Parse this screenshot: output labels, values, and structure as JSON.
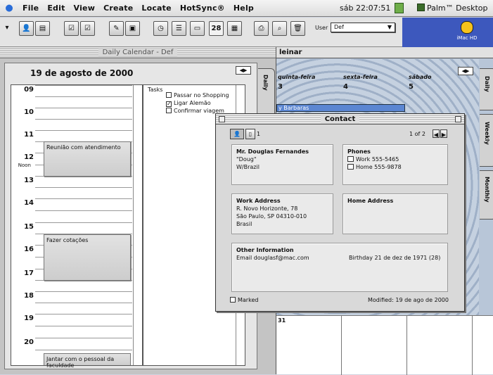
{
  "menubar": {
    "items": [
      "File",
      "Edit",
      "View",
      "Create",
      "Locate",
      "HotSync®",
      "Help"
    ],
    "clock": "sáb 22:07:51",
    "app_name": "Palm™ Desktop"
  },
  "toolbar": {
    "user_label": "User",
    "user_value": "Def",
    "date_button": "28"
  },
  "desktop": {
    "hd_label": "iMac HD"
  },
  "calendar": {
    "window_title": "Daily Calendar - Def",
    "date": "19 de agosto de 2000",
    "hours": [
      "09",
      "10",
      "11",
      "12",
      "13",
      "14",
      "15",
      "16",
      "17",
      "18",
      "19",
      "20"
    ],
    "noon_label": "Noon",
    "appointments": [
      "Reunião com atendimento",
      "Fazer cotações",
      "Jantar com o pessoal da faculdade"
    ],
    "tasks_header": "Tasks",
    "tasks": [
      {
        "label": "Passar no Shopping",
        "done": false
      },
      {
        "label": "Ligar Alemão",
        "done": true
      },
      {
        "label": "Confirmar viagem",
        "done": false
      }
    ],
    "tabs": [
      "Daily",
      "Weekly",
      "Monthly"
    ]
  },
  "month": {
    "title_fragment": "leinar",
    "day_headers": [
      "quinta-feira",
      "sexta-feira",
      "sábado"
    ],
    "day_numbers": [
      "3",
      "4",
      "5"
    ],
    "event": "y Barbaras",
    "bottom_number": "31"
  },
  "contact": {
    "title": "Contact",
    "view_count": "1",
    "page": "1 of 2",
    "name": "Mr. Douglas Fernandes",
    "nickname": "\"Doug\"",
    "company": "W/Brazil",
    "phones_header": "Phones",
    "phones": [
      {
        "type": "Work",
        "number": "555-5465"
      },
      {
        "type": "Home",
        "number": "555-9878"
      }
    ],
    "work_address_header": "Work Address",
    "work_address": [
      "R. Novo Horizonte, 78",
      "São Paulo, SP 04310-010",
      "Brasil"
    ],
    "home_address_header": "Home Address",
    "other_header": "Other Information",
    "email": "Email  douglasf@mac.com",
    "birthday": "Birthday  21 de dez de 1971 (28)",
    "marked_label": "Marked",
    "modified": "Modified: 19 de ago de 2000"
  }
}
